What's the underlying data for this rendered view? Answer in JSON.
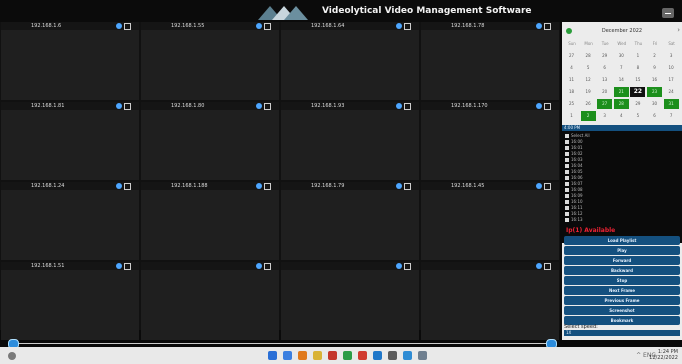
{
  "window": {
    "title": "Videolytical Video Management Software"
  },
  "cameras": [
    [
      "192.168.1.6",
      "192.168.1.55",
      "192.168.1.64",
      "192.168.1.78"
    ],
    [
      "192.168.1.81",
      "192.168.1.80",
      "192.168.1.93",
      "192.168.1.170"
    ],
    [
      "192.168.1.24",
      "192.168.1.188",
      "192.168.1.79",
      "192.168.1.45"
    ],
    [
      "192.168.1.51",
      "",
      "",
      ""
    ]
  ],
  "calendar": {
    "month_label": "December 2022",
    "weekdays": [
      "Sun",
      "Mon",
      "Tue",
      "Wed",
      "Thu",
      "Fri",
      "Sat"
    ],
    "weeks": [
      [
        "27",
        "28",
        "29",
        "30",
        "1",
        "2",
        "3"
      ],
      [
        "4",
        "5",
        "6",
        "7",
        "8",
        "9",
        "10"
      ],
      [
        "11",
        "12",
        "13",
        "14",
        "15",
        "16",
        "17"
      ],
      [
        "18",
        "19",
        "20",
        "21",
        "22",
        "23",
        "24"
      ],
      [
        "25",
        "26",
        "27",
        "28",
        "29",
        "30",
        "31"
      ],
      [
        "1",
        "2",
        "3",
        "4",
        "5",
        "6",
        "7"
      ]
    ],
    "highlighted": [
      [
        3,
        3
      ],
      [
        3,
        4
      ],
      [
        3,
        5
      ],
      [
        4,
        2
      ],
      [
        4,
        3
      ],
      [
        4,
        6
      ],
      [
        5,
        1
      ]
    ],
    "selected": [
      3,
      4
    ]
  },
  "timeline": {
    "header": "4:00 PM",
    "items": [
      "Select All",
      "16:00",
      "16:01",
      "16:02",
      "16:03",
      "16:04",
      "16:05",
      "16:06",
      "16:07",
      "16:08",
      "16:09",
      "16:10",
      "16:11",
      "16:12",
      "16:13"
    ]
  },
  "availability": "Ip(1) Available",
  "controls": {
    "load_playlist": "Load Playlist",
    "play": "Play",
    "forward": "Forward",
    "backward": "Backward",
    "stop": "Stop",
    "next_frame": "Next Frame",
    "previous_frame": "Previous Frame",
    "screenshot": "Screenshot",
    "bookmark": "Bookmark",
    "speed_label": "Select speed:",
    "speed_value": "1X"
  },
  "taskbar": {
    "icon_colors": [
      "#2a6fd6",
      "#3b7fe0",
      "#e07a1c",
      "#d9b336",
      "#c4362b",
      "#2b9c46",
      "#d03a2f",
      "#1f77c9",
      "#5b5b5b",
      "#2f8cd4",
      "#6f7f8f"
    ],
    "tray": "^ ENG",
    "time": "1:24 PM",
    "date": "12/22/2022"
  },
  "seek": {
    "start_position": 0.0,
    "end_position": 1.0
  }
}
